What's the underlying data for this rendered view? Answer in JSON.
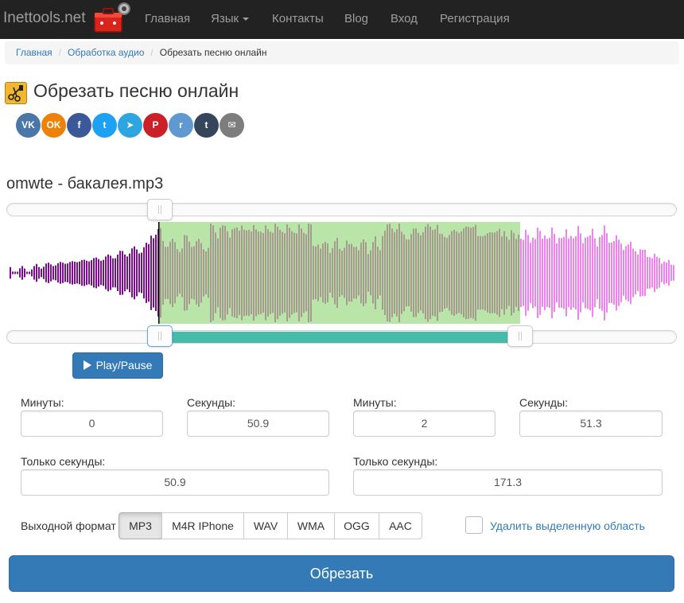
{
  "navbar": {
    "brand": "Inettools.net",
    "items": [
      {
        "label": "Главная"
      },
      {
        "label": "Язык"
      },
      {
        "label": "Контакты"
      },
      {
        "label": "Blog"
      },
      {
        "label": "Вход"
      },
      {
        "label": "Регистрация"
      }
    ]
  },
  "breadcrumb": [
    "Главная",
    "Обработка аудио",
    "Обрезать песню онлайн"
  ],
  "page_title": "Обрезать песню онлайн",
  "share": [
    {
      "label": "VK",
      "icon": "vk-icon",
      "color": "#4a76a8"
    },
    {
      "label": "OK",
      "icon": "odnoklassniki-icon",
      "color": "#ee8208"
    },
    {
      "label": "f",
      "icon": "facebook-icon",
      "color": "#3b5998"
    },
    {
      "label": "t",
      "icon": "twitter-icon",
      "color": "#1da1f2"
    },
    {
      "label": "➤",
      "icon": "telegram-icon",
      "color": "#2ca5e0"
    },
    {
      "label": "P",
      "icon": "pinterest-icon",
      "color": "#cb2027"
    },
    {
      "label": "r",
      "icon": "reddit-icon",
      "color": "#5f99cf"
    },
    {
      "label": "t",
      "icon": "tumblr-icon",
      "color": "#35465c"
    },
    {
      "label": "✉",
      "icon": "email-icon",
      "color": "#7d7d7d"
    }
  ],
  "file_name": "omwte - бакалея.mp3",
  "waveform": {
    "colors": {
      "before": "#7a0e8a",
      "selected": "#a69a91",
      "selected_bg": "#b9e6a8",
      "after": "#ee82ee",
      "cursor": "#000000"
    }
  },
  "play_button": "Play/Pause",
  "start": {
    "minutes_label": "Минуты:",
    "minutes": "0",
    "seconds_label": "Секунды:",
    "seconds": "50.9",
    "only_seconds_label": "Только секунды:",
    "only_seconds": "50.9"
  },
  "end": {
    "minutes_label": "Минуты:",
    "minutes": "2",
    "seconds_label": "Секунды:",
    "seconds": "51.3",
    "only_seconds_label": "Только секунды:",
    "only_seconds": "171.3"
  },
  "output_format_label": "Выходной формат",
  "formats": [
    "MP3",
    "M4R IPhone",
    "WAV",
    "WMA",
    "OGG",
    "AAC"
  ],
  "selected_format": "MP3",
  "delete_selection_label": "Удалить выделенную область",
  "submit_button": "Обрезать",
  "accent_color": "#337ab7",
  "range_color": "#45bcaa"
}
